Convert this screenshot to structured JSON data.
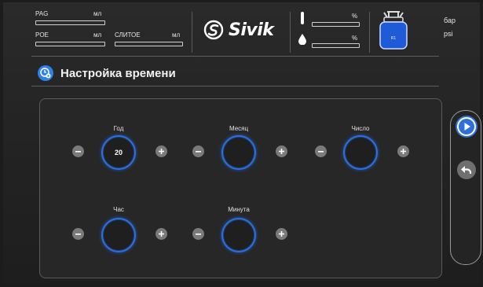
{
  "header": {
    "pag_label": "PAG",
    "pag_unit": "мл",
    "poe_label": "POE",
    "poe_unit": "мл",
    "uv_label": "СЛИТОЕ",
    "uv_unit": "мл",
    "brand": "Sivik",
    "level1_unit": "%",
    "level2_unit": "%",
    "tank_label": "R1",
    "pressure_unit_1": "бар",
    "pressure_unit_2": "psi"
  },
  "page": {
    "title": "Настройка времени"
  },
  "fields": [
    {
      "label": "Год",
      "value": "20"
    },
    {
      "label": "Месяц",
      "value": ""
    },
    {
      "label": "Число",
      "value": ""
    },
    {
      "label": "Час",
      "value": ""
    },
    {
      "label": "Минута",
      "value": ""
    }
  ],
  "colors": {
    "accent": "#2f82e6",
    "dial": "#2e6fd8",
    "background": "#222222"
  },
  "icons": {
    "title": "clock-settings-icon",
    "next": "play-icon",
    "back": "back-arrow-icon",
    "tank": "refrigerant-tank-icon",
    "drop": "drop-icon",
    "thermometer": "bar-level-icon"
  }
}
